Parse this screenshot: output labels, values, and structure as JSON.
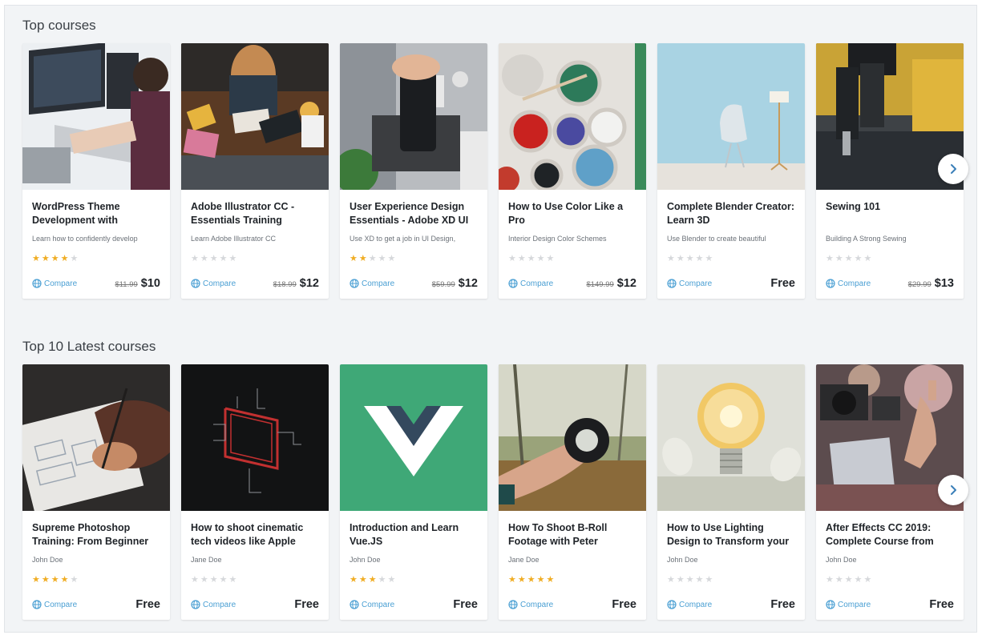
{
  "sections": [
    {
      "title": "Top courses",
      "cards": [
        {
          "title": "WordPress Theme Development with",
          "subtitle": "Learn how to confidently develop",
          "rating": 4,
          "compare": "Compare",
          "old_price": "$11.99",
          "price": "$10",
          "image": "developer-at-desk"
        },
        {
          "title": "Adobe Illustrator CC - Essentials Training",
          "subtitle": "Learn Adobe Illustrator CC",
          "rating": 0,
          "compare": "Compare",
          "old_price": "$18.99",
          "price": "$12",
          "image": "designer-with-tablet"
        },
        {
          "title": "User Experience Design Essentials - Adobe XD UI",
          "subtitle": "Use XD to get a job in UI Design,",
          "rating": 2,
          "compare": "Compare",
          "old_price": "$59.99",
          "price": "$12",
          "image": "hand-holding-phone"
        },
        {
          "title": "How to Use Color Like a Pro",
          "subtitle": "Interior Design Color Schemes",
          "rating": 0,
          "compare": "Compare",
          "old_price": "$149.99",
          "price": "$12",
          "image": "paint-cans"
        },
        {
          "title": "Complete Blender Creator: Learn 3D",
          "subtitle": "Use Blender to create beautiful",
          "rating": 0,
          "compare": "Compare",
          "old_price": "",
          "price": "Free",
          "image": "egg-chair-room"
        },
        {
          "title": "Sewing 101",
          "subtitle": "Building A Strong Sewing",
          "rating": 0,
          "compare": "Compare",
          "old_price": "$29.99",
          "price": "$13",
          "image": "sewing-machine"
        }
      ]
    },
    {
      "title": "Top 10 Latest courses",
      "cards": [
        {
          "title": "Supreme Photoshop Training: From Beginner",
          "subtitle": "John Doe",
          "rating": 4,
          "compare": "Compare",
          "old_price": "",
          "price": "Free",
          "image": "hand-sketching-wireframe"
        },
        {
          "title": "How to shoot cinematic tech videos like Apple",
          "subtitle": "Jane Doe",
          "rating": 0,
          "compare": "Compare",
          "old_price": "",
          "price": "Free",
          "image": "neon-line-art"
        },
        {
          "title": "Introduction and Learn Vue.JS",
          "subtitle": "John Doe",
          "rating": 3,
          "compare": "Compare",
          "old_price": "",
          "price": "Free",
          "image": "vue-logo"
        },
        {
          "title": "How To Shoot B-Roll Footage with Peter",
          "subtitle": "Jane Doe",
          "rating": 5,
          "compare": "Compare",
          "old_price": "",
          "price": "Free",
          "image": "hand-holding-lens"
        },
        {
          "title": "How to Use Lighting Design to Transform your",
          "subtitle": "John Doe",
          "rating": 0,
          "compare": "Compare",
          "old_price": "",
          "price": "Free",
          "image": "light-bulb"
        },
        {
          "title": "After Effects CC 2019: Complete Course from",
          "subtitle": "John Doe",
          "rating": 0,
          "compare": "Compare",
          "old_price": "",
          "price": "Free",
          "image": "press-cameras"
        }
      ]
    }
  ],
  "colors": {
    "accent": "#4a9fd3",
    "star_on": "#f0ad24",
    "star_off": "#d6d8db",
    "background": "#f2f4f6",
    "vue_green": "#42b883",
    "vue_dark": "#35495e"
  },
  "icons": {
    "compare": "globe-icon",
    "next": "chevron-right-icon",
    "star": "star-icon"
  }
}
